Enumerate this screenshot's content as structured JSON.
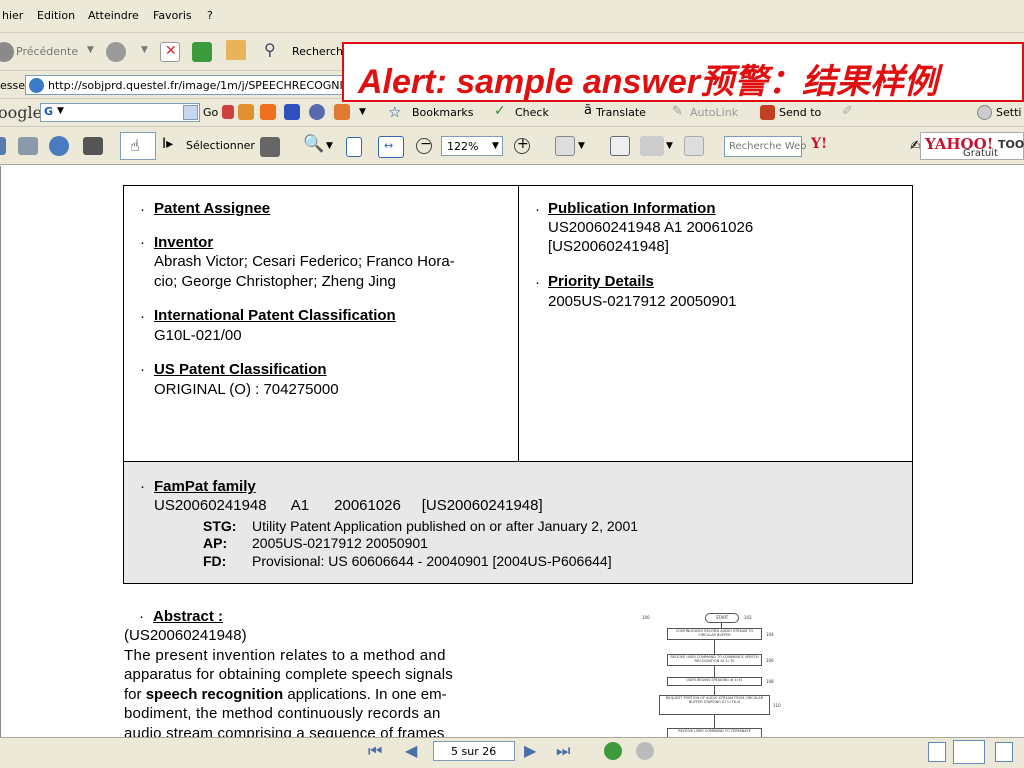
{
  "menu": {
    "items": [
      "hier",
      "Edition",
      "Atteindre",
      "Favoris",
      "?"
    ]
  },
  "nav": {
    "back_label": "Précédente",
    "search_label": "Recherch"
  },
  "address": {
    "label": "esse",
    "url": "http://sobjprd.questel.fr/image/1m/j/SPEECHRECOGNI-A"
  },
  "google": {
    "logo": "oogle",
    "g_label": "G",
    "go_label": "Go",
    "bookmarks_label": "Bookmarks",
    "check_label": "Check",
    "translate_label": "Translate",
    "autolink_label": "AutoLink",
    "sendto_label": "Send to",
    "settings_label": "Setti"
  },
  "acrobat": {
    "select_label": "Sélectionner",
    "zoom_value": "122%",
    "search_placeholder": "Recherche Web",
    "yahoo_logo": "YAHOO!",
    "yahoo_toolbar": "TOO",
    "yahoo_gratuit": "Gratuit"
  },
  "alert": {
    "text": "Alert: sample answer预警：结果样例"
  },
  "doc": {
    "bullet": "·",
    "patent_assignee_label": "Patent Assignee",
    "inventor_label": "Inventor",
    "inventor_line1": "Abrash Victor; Cesari Federico; Franco Hora-",
    "inventor_line2": "cio; George Christopher; Zheng Jing",
    "ipc_label": "International Patent Classification",
    "ipc_value": "G10L-021/00",
    "uspc_label": "US Patent Classification",
    "uspc_value": "ORIGINAL (O) : 704275000",
    "pub_label": "Publication Information",
    "pub_line1": "US20060241948 A1 20061026",
    "pub_line2": "[US20060241948]",
    "priority_label": "Priority Details",
    "priority_value": "2005US-0217912 20050901",
    "fampat_label": "FamPat family",
    "fampat_line": "US20060241948      A1      20061026     [US20060241948]",
    "stg_key": "STG:",
    "stg_val": "Utility Patent Application published on or after January 2, 2001",
    "ap_key": "AP:",
    "ap_val": "2005US-0217912 20050901",
    "fd_key": "FD:",
    "fd_val": "Provisional: US 60606644 - 20040901 [2004US-P606644]",
    "abstract_label": "Abstract :",
    "abstract_id": "(US20060241948)",
    "abstract_l1": "The present invention relates to a method and",
    "abstract_l2": "apparatus for obtaining complete speech signals",
    "abstract_l3a": "for ",
    "abstract_l3b": "speech recognition",
    "abstract_l3c": " applications. In one em-",
    "abstract_l4": "bodiment, the method continuously records an",
    "abstract_l5": "audio stream comprising a sequence of frames",
    "flow_start": "START",
    "flow_boxes": [
      "CONTINUOUSLY RECORD AUDIO STREAM TO CIRCULAR BUFFER",
      "RECEIVE USER COMMAND TO COMMENCE SPEECH RECOGNITION AT t=T0",
      "USER BEGINS SPEAKING at t=t1",
      "REQUEST PORTION OF AUDIO STREAM FROM CIRCULAR BUFFER STARTING AT t=T0-N",
      "RECEIVE USER COMMAND TO TERMINATE"
    ],
    "flow_refs": [
      "100",
      "102",
      "104",
      "106",
      "108",
      "110"
    ]
  },
  "status": {
    "page_text": "5 sur 26"
  }
}
